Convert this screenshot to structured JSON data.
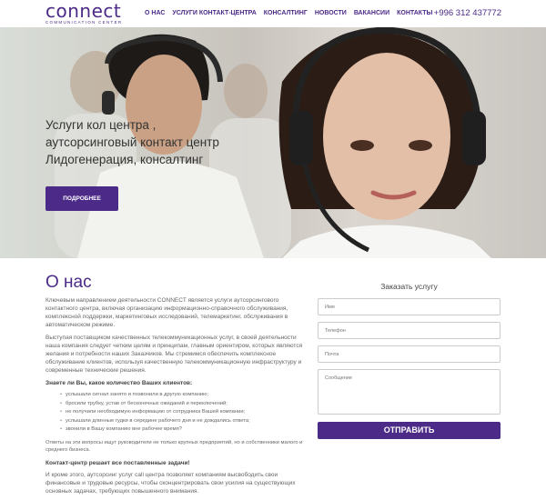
{
  "header": {
    "logo_word": "connect",
    "logo_sub": "COMMUNICATION CENTER",
    "nav": [
      "О НАС",
      "УСЛУГИ КОНТАКТ-ЦЕНТРА",
      "КОНСАЛТИНГ",
      "НОВОСТИ",
      "ВАКАНСИИ",
      "КОНТАКТЫ"
    ],
    "phone": "+996 312 437772"
  },
  "hero": {
    "title_lines": [
      "Услуги кол центра ,",
      "аутсорсинговый контакт центр",
      "Лидогенерация, консалтинг"
    ],
    "button": "ПОДРОБНЕЕ"
  },
  "about": {
    "title": "О нас",
    "p1": "Ключевым направлением деятельности CONNECT является услуги аутсорсингового контактного центра, включая организацию информационно-справочного обслуживания, комплексной поддержки, маркетинговых исследований, телемаркетинг, обслуживания в автоматическом режиме.",
    "p2": "Выступая поставщиком качественных телекоммуникационных услуг, в своей деятельности наша компания следует четким целям и принципам, главным ориентиром, которых являются желания и потребности наших Заказчиков. Мы стремимся обеспечить комплексное обслуживание клиентов, используя качественную телекоммуникационную инфраструктуру и современные технические решения.",
    "question": "Знаете ли Вы, какое количество Ваших клиентов:",
    "list": [
      "услышали сигнал занято и позвонили в другую компанию;",
      "бросили трубку, устав от бесконечных ожиданий и переключений;",
      "не получили необходимую информацию от сотрудника Вашей компании;",
      "услышали длинные гудки в середине рабочего дня и не дождались ответа;",
      "звонили в Вашу компанию вне рабочее время?"
    ],
    "p3": "Ответы на эти вопросы ищут руководители не только крупных предприятий, но и собственники малого и среднего бизнеса.",
    "p4": "Контакт-центр решает все поставленные задачи!",
    "p5": "И кроме этого, аутсорсинг услуг call центра позволяет компаниям высвободить свои финансовые и трудовые ресурсы, чтобы сконцентрировать свои усилия на существующих основных задачах, требующих повышенного внимания."
  },
  "form": {
    "title": "Заказать услугу",
    "name_placeholder": "Имя",
    "phone_placeholder": "Телефон",
    "email_placeholder": "Почта",
    "message_placeholder": "Сообщение",
    "submit": "ОТПРАВИТЬ"
  }
}
